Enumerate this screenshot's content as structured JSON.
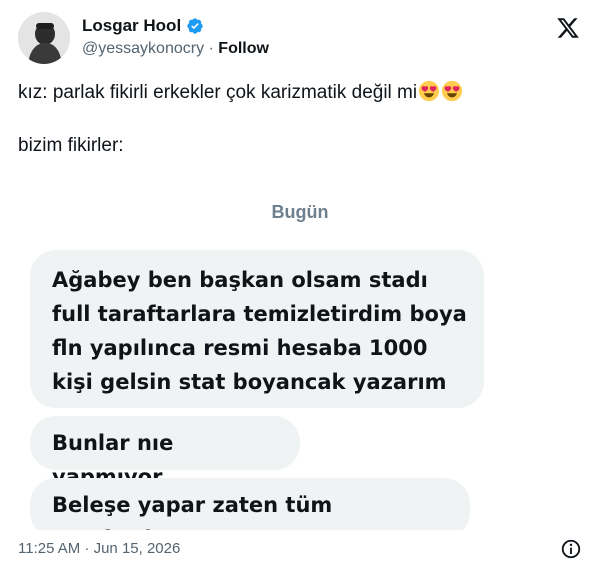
{
  "author": {
    "name": "Losgar Hool",
    "handle": "@yessaykonocry",
    "separator": "·",
    "follow_label": "Follow"
  },
  "tweet": {
    "line1": "kız: parlak fikirli erkekler çok karizmatik değil mi",
    "line1_emojis": [
      "heart-eyes-emoji",
      "heart-eyes-emoji"
    ],
    "line2": "bizim fikirler:"
  },
  "screenshot": {
    "day_label": "Bugün",
    "messages": [
      "Ağabey ben başkan olsam stadı full taraftarlara temizletirdim boya fln yapılınca resmi hesaba 1000 kişi gelsin stat boyancak yazarım",
      "Bunlar nıe yapmıyor",
      "Beleşe yapar zaten tüm taraftarlar"
    ],
    "colors": {
      "bubble": "#f0f3f4",
      "day_label": "#6e7f8e"
    }
  },
  "footer": {
    "timestamp": "11:25 AM · Jun 15, 2026"
  },
  "icons": [
    "verified-badge-icon",
    "x-logo-icon",
    "info-icon"
  ],
  "colors": {
    "text": "#0f1419",
    "secondary": "#536471",
    "verified": "#1d9bf0"
  }
}
